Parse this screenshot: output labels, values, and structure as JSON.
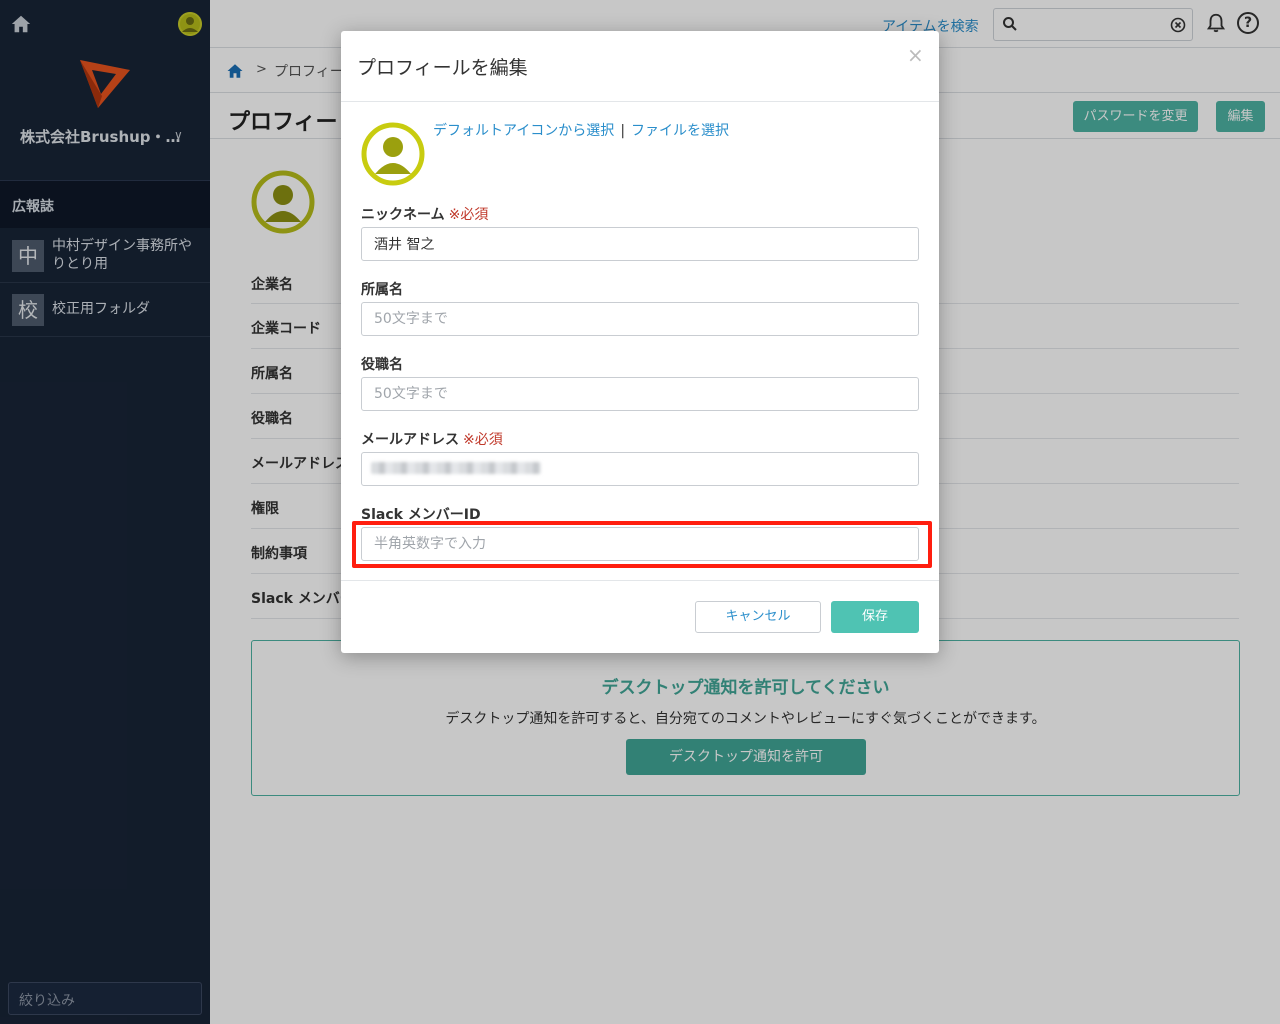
{
  "sidebar": {
    "company": "株式会社Brushup・…",
    "section": "広報誌",
    "items": [
      {
        "badge": "中",
        "label_line1": "中村デザイン事務所や",
        "label_line2": "りとり用"
      },
      {
        "badge": "校",
        "label_line1": "校正用フォルダ",
        "label_line2": ""
      }
    ],
    "filter_placeholder": "絞り込み"
  },
  "topbar": {
    "search_link": "アイテムを検索",
    "help_glyph": "?"
  },
  "breadcrumb": {
    "separator": ">",
    "current": "プロフィー"
  },
  "page": {
    "title": "プロフィー",
    "change_password": "パスワードを変更",
    "edit": "編集",
    "fields": [
      "企業名",
      "企業コード",
      "所属名",
      "役職名",
      "メールアドレス",
      "権限",
      "制約事項",
      "Slack メンバー"
    ]
  },
  "notification": {
    "title": "デスクトップ通知を許可してください",
    "text": "デスクトップ通知を許可すると、自分宛てのコメントやレビューにすぐ気づくことができます。",
    "button": "デスクトップ通知を許可"
  },
  "modal": {
    "title": "プロフィールを編集",
    "close": "×",
    "link_default_icon": "デフォルトアイコンから選択",
    "link_separator": "|",
    "link_file": "ファイルを選択",
    "required_mark": "※必須",
    "nickname_label": "ニックネーム",
    "nickname_value": "酒井 智之",
    "department_label": "所属名",
    "department_placeholder": "50文字まで",
    "position_label": "役職名",
    "position_placeholder": "50文字まで",
    "email_label": "メールアドレス",
    "slack_label": "Slack メンバーID",
    "slack_placeholder": "半角英数字で入力",
    "cancel": "キャンセル",
    "save": "保存"
  },
  "colors": {
    "sidebar_bg": "#182437",
    "accent_teal": "#4db3a3",
    "link_blue": "#2a8ecb",
    "required_red": "#c0392b",
    "highlight_red": "#ff1e0f",
    "avatar_yellow": "#b7bd1a"
  }
}
